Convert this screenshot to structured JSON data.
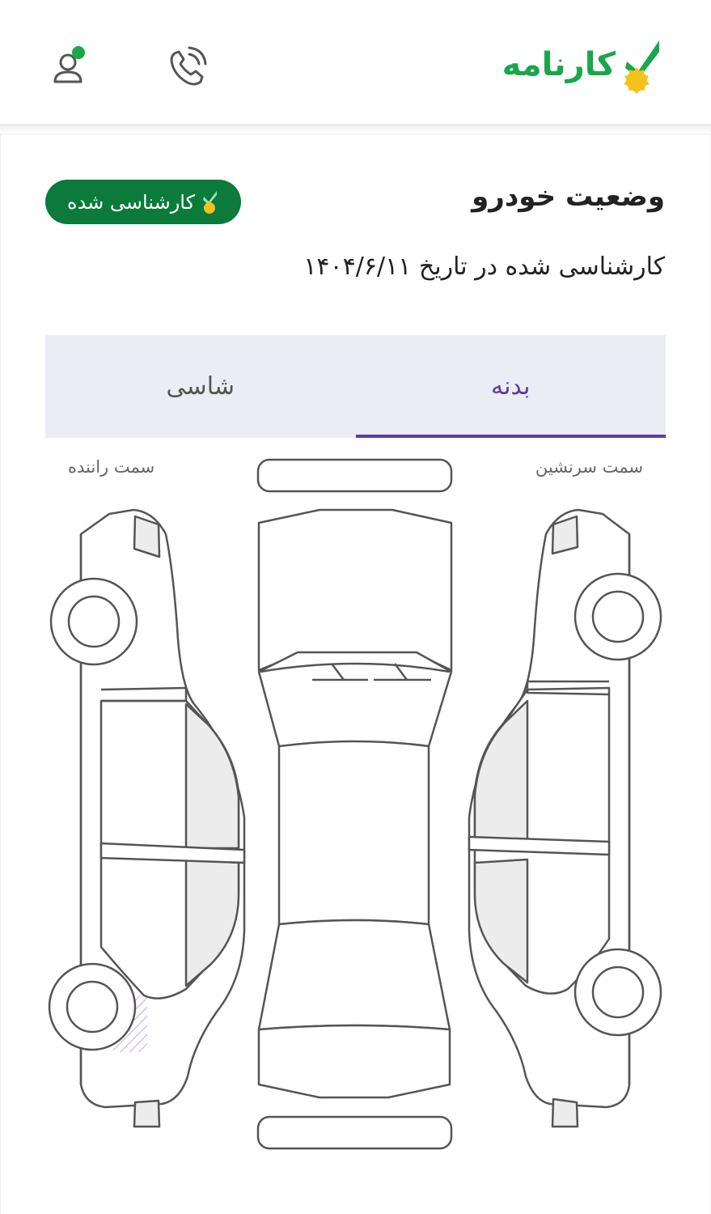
{
  "header": {
    "logo_text": "کارنامه",
    "brand_color": "#1aa64a",
    "icons": [
      "logo-check-icon",
      "phone-icon",
      "user-icon"
    ]
  },
  "status": {
    "title": "وضعیت خودرو",
    "badge_label": "کارشناسی شده",
    "badge_color": "#0b7a3a",
    "inspection_text": "کارشناسی شده در تاریخ ۱۴۰۴/۶/۱۱"
  },
  "tabs": [
    {
      "label": "بدنه",
      "active": true
    },
    {
      "label": "شاسی",
      "active": false
    }
  ],
  "accent_color": "#5b3fa0",
  "diagram": {
    "passenger_side_label": "سمت سرنشین",
    "driver_side_label": "سمت راننده"
  }
}
